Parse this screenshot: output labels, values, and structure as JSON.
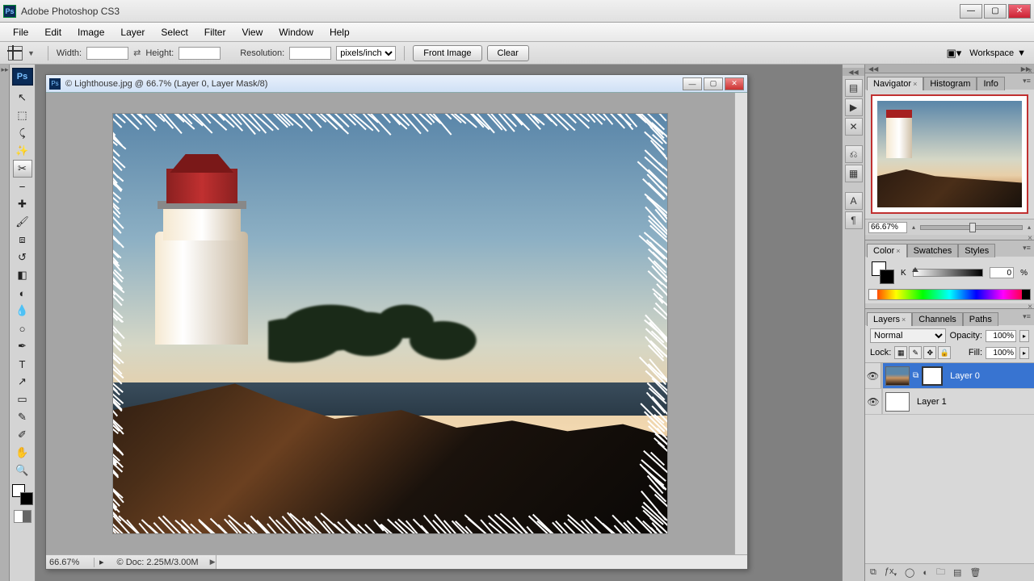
{
  "app": {
    "title": "Adobe Photoshop CS3",
    "badge": "Ps"
  },
  "menu": [
    "File",
    "Edit",
    "Image",
    "Layer",
    "Select",
    "Filter",
    "View",
    "Window",
    "Help"
  ],
  "options": {
    "width_label": "Width:",
    "height_label": "Height:",
    "resolution_label": "Resolution:",
    "units": "pixels/inch",
    "front_image": "Front Image",
    "clear": "Clear",
    "workspace": "Workspace"
  },
  "tools": [
    {
      "name": "move-tool",
      "glyph": "↖"
    },
    {
      "name": "marquee-tool",
      "glyph": "⬚"
    },
    {
      "name": "lasso-tool",
      "glyph": "⤹"
    },
    {
      "name": "magic-wand-tool",
      "glyph": "✨"
    },
    {
      "name": "crop-tool",
      "glyph": "✂",
      "selected": true
    },
    {
      "name": "slice-tool",
      "glyph": "⎯"
    },
    {
      "name": "healing-tool",
      "glyph": "✚"
    },
    {
      "name": "brush-tool",
      "glyph": "🖌"
    },
    {
      "name": "stamp-tool",
      "glyph": "⧈"
    },
    {
      "name": "history-brush-tool",
      "glyph": "↺"
    },
    {
      "name": "eraser-tool",
      "glyph": "◧"
    },
    {
      "name": "gradient-tool",
      "glyph": "◐"
    },
    {
      "name": "blur-tool",
      "glyph": "💧"
    },
    {
      "name": "dodge-tool",
      "glyph": "○"
    },
    {
      "name": "pen-tool",
      "glyph": "✒"
    },
    {
      "name": "type-tool",
      "glyph": "T"
    },
    {
      "name": "path-select-tool",
      "glyph": "↗"
    },
    {
      "name": "rectangle-tool",
      "glyph": "▭"
    },
    {
      "name": "notes-tool",
      "glyph": "✎"
    },
    {
      "name": "eyedropper-tool",
      "glyph": "✐"
    },
    {
      "name": "hand-tool",
      "glyph": "✋"
    },
    {
      "name": "zoom-tool",
      "glyph": "🔍"
    }
  ],
  "document": {
    "title": "© Lighthouse.jpg @ 66.7% (Layer 0, Layer Mask/8)",
    "zoom": "66.67%",
    "doc_info": "© Doc: 2.25M/3.00M"
  },
  "navigator": {
    "tabs": [
      "Navigator",
      "Histogram",
      "Info"
    ],
    "zoom": "66.67%"
  },
  "color": {
    "tabs": [
      "Color",
      "Swatches",
      "Styles"
    ],
    "channel": "K",
    "value": "0",
    "pct": "%"
  },
  "layers": {
    "tabs": [
      "Layers",
      "Channels",
      "Paths"
    ],
    "blend_mode": "Normal",
    "opacity_label": "Opacity:",
    "opacity": "100%",
    "lock_label": "Lock:",
    "fill_label": "Fill:",
    "fill": "100%",
    "items": [
      {
        "name": "Layer 0",
        "selected": true,
        "has_mask": true,
        "thumb": "img"
      },
      {
        "name": "Layer 1",
        "selected": false,
        "has_mask": false,
        "thumb": "white"
      }
    ]
  },
  "dock_icons": [
    {
      "name": "brushes-icon",
      "glyph": "▤"
    },
    {
      "name": "clone-source-icon",
      "glyph": "▶"
    },
    {
      "name": "tool-presets-icon",
      "glyph": "✕"
    },
    {
      "name": "layer-comps-icon",
      "glyph": "⎌"
    },
    {
      "name": "actions-icon",
      "glyph": "▦"
    },
    {
      "name": "character-icon",
      "glyph": "A"
    },
    {
      "name": "paragraph-icon",
      "glyph": "¶"
    }
  ]
}
